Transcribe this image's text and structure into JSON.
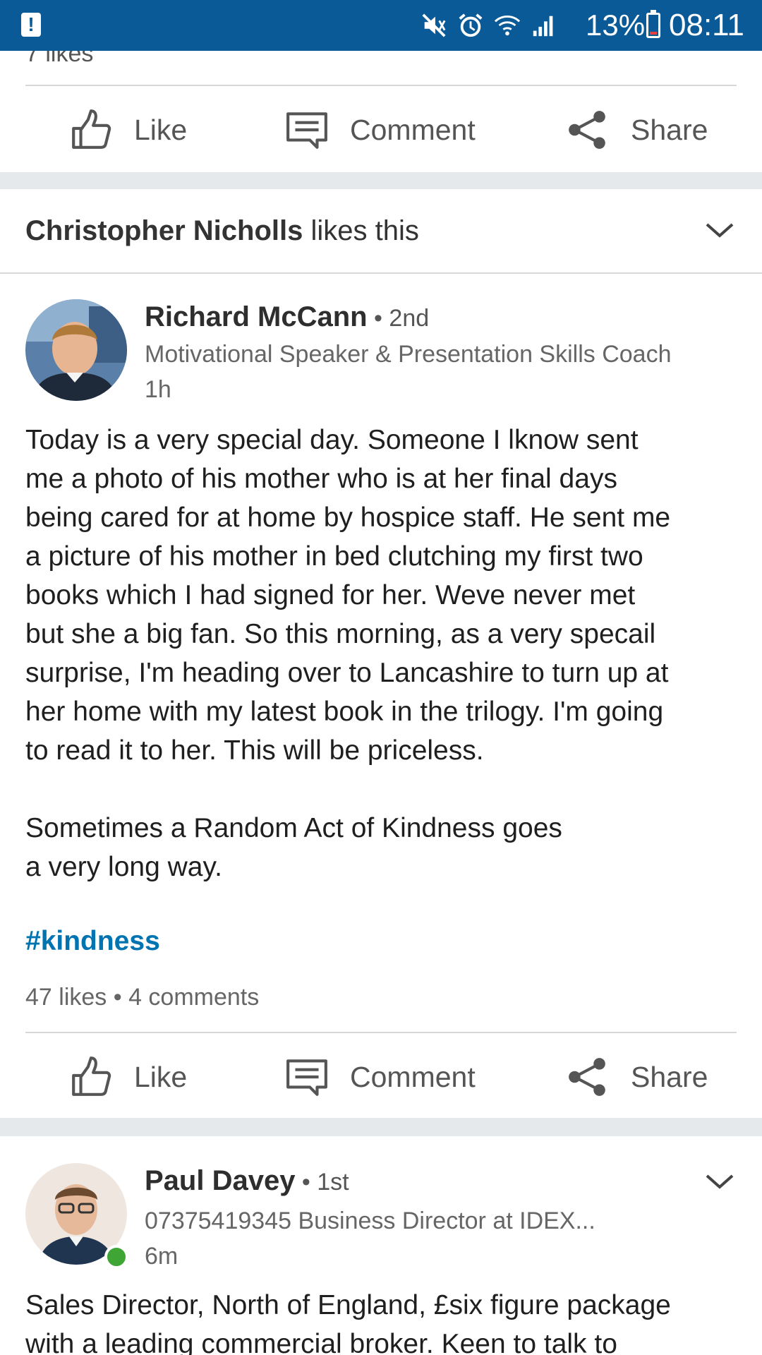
{
  "status_bar": {
    "battery": "13%",
    "time": "08:11",
    "icons": [
      "notification-icon",
      "mute-icon",
      "alarm-icon",
      "wifi-icon",
      "signal-icon",
      "battery-icon"
    ]
  },
  "prev_post": {
    "likes_text": "7 likes",
    "actions": {
      "like": "Like",
      "comment": "Comment",
      "share": "Share"
    }
  },
  "post1": {
    "liker_name": "Christopher Nicholls",
    "liker_suffix": " likes this",
    "author": {
      "name": "Richard McCann",
      "degree": "2nd",
      "headline": "Motivational Speaker & Presentation Skills Coach",
      "time": "1h"
    },
    "body": "Today is a very special day. Someone I lknow sent\nme a photo of his mother who is at her final days\nbeing cared for at home by hospice staff. He sent me\na picture of his mother in bed clutching my first two\nbooks which I had signed for her. Weve never met\nbut she a big fan. So this morning, as a very specail\nsurprise, I'm heading over to Lancashire to turn up at\nher home with my latest book in the trilogy. I'm going\nto read it to her. This will be priceless.\n\nSometimes a Random Act of Kindness goes\na very long way.",
    "hashtag": "#kindness",
    "likes": "47 likes",
    "comments": "4 comments",
    "actions": {
      "like": "Like",
      "comment": "Comment",
      "share": "Share"
    }
  },
  "post2": {
    "author": {
      "name": "Paul Davey",
      "degree": "1st",
      "headline": "07375419345 Business Director at IDEX...",
      "time": "6m"
    },
    "body": "Sales Director, North of England, £six figure package\nwith a leading commercial broker. Keen to talk to"
  },
  "colors": {
    "status_bar": "#0a5a98",
    "link": "#0073b1",
    "online": "#3fa535"
  }
}
